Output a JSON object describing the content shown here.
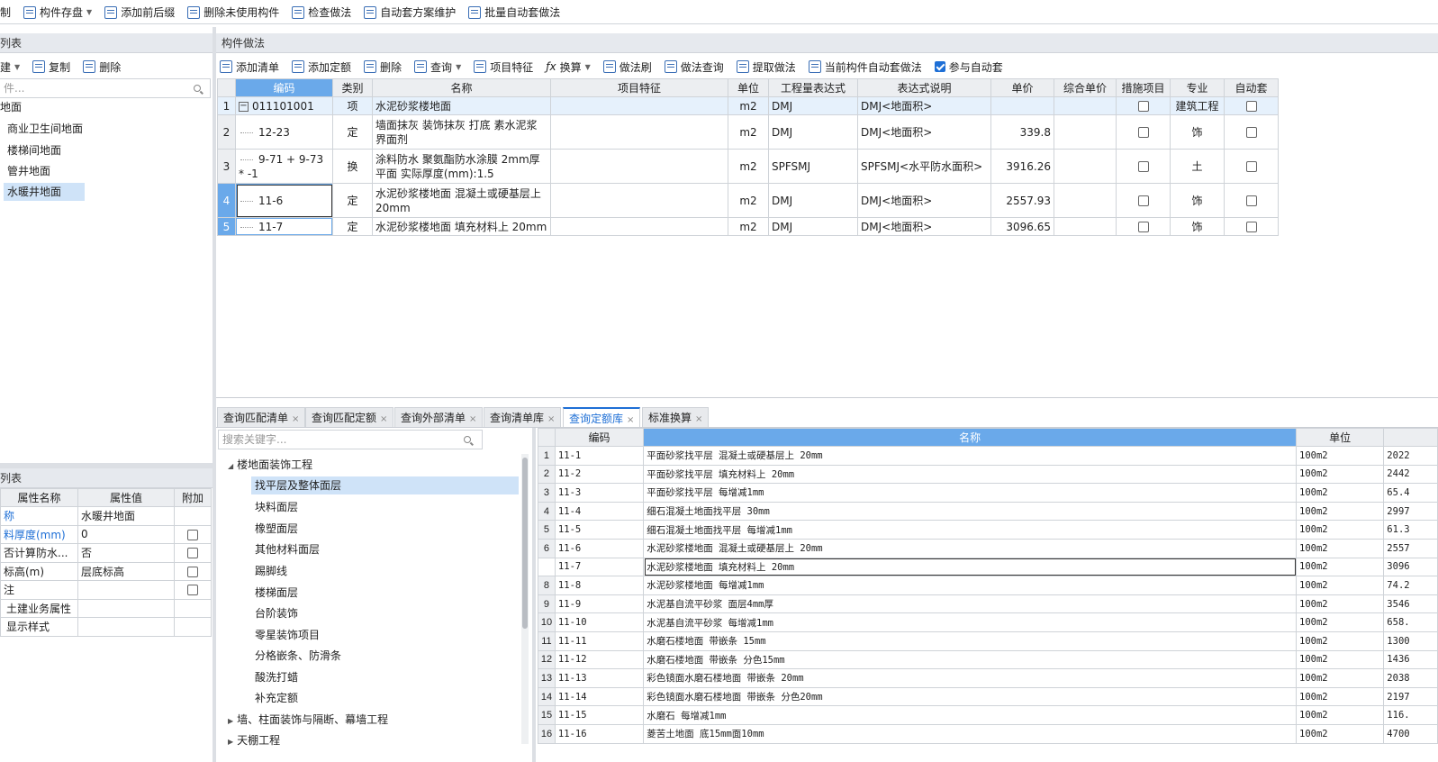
{
  "top_toolbar": [
    "制",
    "构件存盘",
    "添加前后缀",
    "删除未使用构件",
    "检查做法",
    "自动套方案维护",
    "批量自动套做法"
  ],
  "left_panel": {
    "title": "列表",
    "toolbar": [
      "建",
      "复制",
      "删除"
    ],
    "search_placeholder": "件...",
    "tree_root": "地面",
    "tree_items": [
      "商业卫生间地面",
      "楼梯间地面",
      "管井地面",
      "水暖井地面"
    ]
  },
  "prop_panel": {
    "title": "列表",
    "headers": [
      "属性名称",
      "属性值",
      "附加"
    ],
    "rows": [
      {
        "name": "称",
        "value": "水暖井地面",
        "blue": true,
        "check": false
      },
      {
        "name": "料厚度(mm)",
        "value": "0",
        "blue": true,
        "check": true
      },
      {
        "name": "否计算防水...",
        "value": "否",
        "blue": false,
        "check": true
      },
      {
        "name": "标高(m)",
        "value": "层底标高",
        "blue": false,
        "check": true
      },
      {
        "name": "注",
        "value": "",
        "blue": false,
        "check": true
      },
      {
        "name": "土建业务属性",
        "value": "",
        "blue": false,
        "check": false
      },
      {
        "name": "显示样式",
        "value": "",
        "blue": false,
        "check": false
      }
    ]
  },
  "main_panel": {
    "title": "构件做法",
    "toolbar": [
      "添加清单",
      "添加定额",
      "删除",
      "查询",
      "项目特征",
      "换算",
      "做法刷",
      "做法查询",
      "提取做法",
      "当前构件自动套做法",
      "参与自动套"
    ],
    "headers": [
      "编码",
      "类别",
      "名称",
      "项目特征",
      "单位",
      "工程量表达式",
      "表达式说明",
      "单价",
      "综合单价",
      "措施项目",
      "专业",
      "自动套"
    ],
    "rows": [
      {
        "num": "1",
        "code": "011101001",
        "type": "项",
        "name": "水泥砂浆楼地面",
        "feature": "",
        "unit": "m2",
        "expr": "DMJ",
        "desc": "DMJ<地面积>",
        "price": "",
        "comp": "",
        "spec": "建筑工程"
      },
      {
        "num": "2",
        "code": "12-23",
        "type": "定",
        "name": "墙面抹灰 装饰抹灰 打底 素水泥浆界面剂",
        "feature": "",
        "unit": "m2",
        "expr": "DMJ",
        "desc": "DMJ<地面积>",
        "price": "339.8",
        "comp": "",
        "spec": "饰"
      },
      {
        "num": "3",
        "code": "9-71 + 9-73 * -1",
        "type": "换",
        "name": "涂料防水 聚氨酯防水涂膜 2mm厚 平面  实际厚度(mm):1.5",
        "feature": "",
        "unit": "m2",
        "expr": "SPFSMJ",
        "desc": "SPFSMJ<水平防水面积>",
        "price": "3916.26",
        "comp": "",
        "spec": "土"
      },
      {
        "num": "4",
        "code": "11-6",
        "type": "定",
        "name": "水泥砂浆楼地面 混凝土或硬基层上 20mm",
        "feature": "",
        "unit": "m2",
        "expr": "DMJ",
        "desc": "DMJ<地面积>",
        "price": "2557.93",
        "comp": "",
        "spec": "饰"
      },
      {
        "num": "5",
        "code": "11-7",
        "type": "定",
        "name": "水泥砂浆楼地面 填充材料上 20mm",
        "feature": "",
        "unit": "m2",
        "expr": "DMJ",
        "desc": "DMJ<地面积>",
        "price": "3096.65",
        "comp": "",
        "spec": "饰"
      }
    ]
  },
  "bottom_tabs": [
    "查询匹配清单",
    "查询匹配定额",
    "查询外部清单",
    "查询清单库",
    "查询定额库",
    "标准换算"
  ],
  "lib_search_placeholder": "搜索关键字...",
  "lib_tree": {
    "root": "楼地面装饰工程",
    "items": [
      "找平层及整体面层",
      "块料面层",
      "橡塑面层",
      "其他材料面层",
      "踢脚线",
      "楼梯面层",
      "台阶装饰",
      "零星装饰项目",
      "分格嵌条、防滑条",
      "酸洗打蜡",
      "补充定额"
    ],
    "others": [
      "墙、柱面装饰与隔断、幕墙工程",
      "天棚工程"
    ]
  },
  "lib_grid": {
    "headers": [
      "编码",
      "名称",
      "单位"
    ],
    "rows": [
      {
        "num": "1",
        "code": "11-1",
        "name": "平面砂浆找平层 混凝土或硬基层上 20mm",
        "unit": "100m2",
        "price": "2022"
      },
      {
        "num": "2",
        "code": "11-2",
        "name": "平面砂浆找平层 填充材料上 20mm",
        "unit": "100m2",
        "price": "2442"
      },
      {
        "num": "3",
        "code": "11-3",
        "name": "平面砂浆找平层 每增减1mm",
        "unit": "100m2",
        "price": "65.4"
      },
      {
        "num": "4",
        "code": "11-4",
        "name": "细石混凝土地面找平层 30mm",
        "unit": "100m2",
        "price": "2997"
      },
      {
        "num": "5",
        "code": "11-5",
        "name": "细石混凝土地面找平层 每增减1mm",
        "unit": "100m2",
        "price": "61.3"
      },
      {
        "num": "6",
        "code": "11-6",
        "name": "水泥砂浆楼地面 混凝土或硬基层上 20mm",
        "unit": "100m2",
        "price": "2557"
      },
      {
        "num": "7",
        "code": "11-7",
        "name": "水泥砂浆楼地面 填充材料上 20mm",
        "unit": "100m2",
        "price": "3096"
      },
      {
        "num": "8",
        "code": "11-8",
        "name": "水泥砂浆楼地面 每增减1mm",
        "unit": "100m2",
        "price": "74.2"
      },
      {
        "num": "9",
        "code": "11-9",
        "name": "水泥基自流平砂浆 面层4mm厚",
        "unit": "100m2",
        "price": "3546"
      },
      {
        "num": "10",
        "code": "11-10",
        "name": "水泥基自流平砂浆 每增减1mm",
        "unit": "100m2",
        "price": "658."
      },
      {
        "num": "11",
        "code": "11-11",
        "name": "水磨石楼地面 带嵌条 15mm",
        "unit": "100m2",
        "price": "1300"
      },
      {
        "num": "12",
        "code": "11-12",
        "name": "水磨石楼地面 带嵌条 分色15mm",
        "unit": "100m2",
        "price": "1436"
      },
      {
        "num": "13",
        "code": "11-13",
        "name": "彩色镜面水磨石楼地面 带嵌条 20mm",
        "unit": "100m2",
        "price": "2038"
      },
      {
        "num": "14",
        "code": "11-14",
        "name": "彩色镜面水磨石楼地面 带嵌条 分色20mm",
        "unit": "100m2",
        "price": "2197"
      },
      {
        "num": "15",
        "code": "11-15",
        "name": "水磨石 每增减1mm",
        "unit": "100m2",
        "price": "116."
      },
      {
        "num": "16",
        "code": "11-16",
        "name": "菱苦土地面 底15mm面10mm",
        "unit": "100m2",
        "price": "4700"
      }
    ]
  }
}
